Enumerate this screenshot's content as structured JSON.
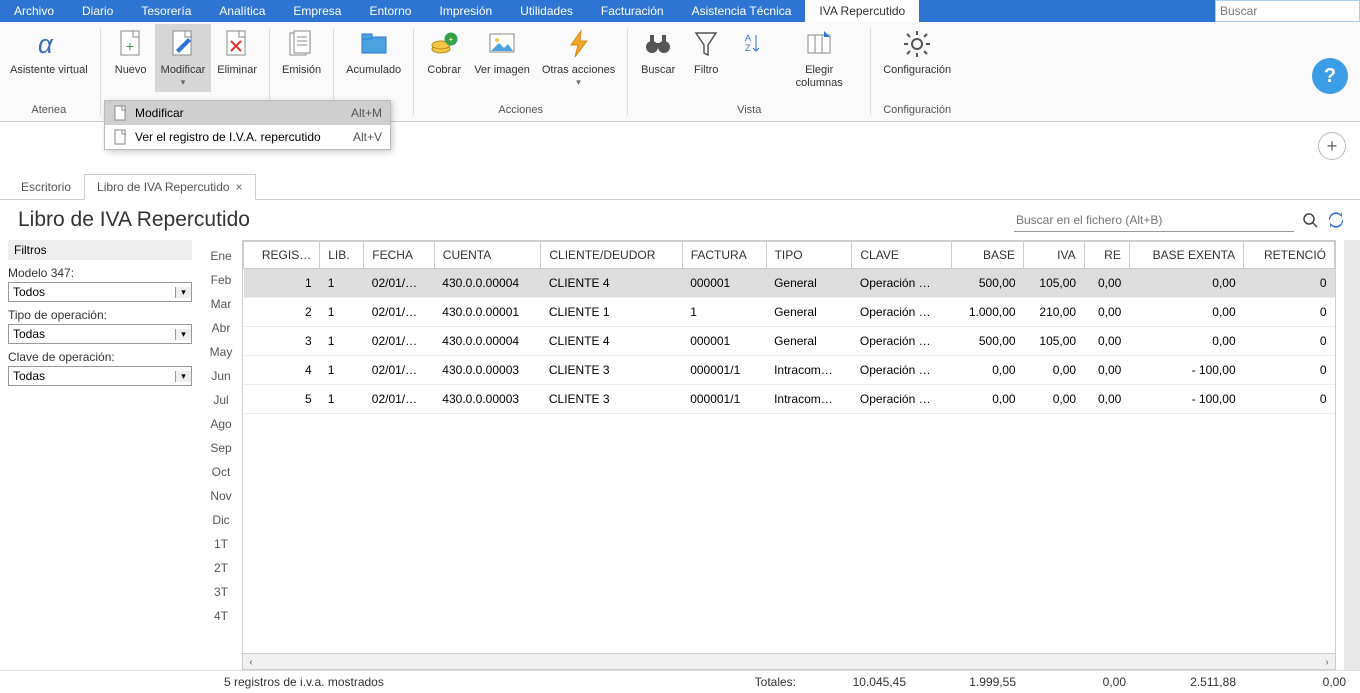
{
  "menu": {
    "items": [
      "Archivo",
      "Diario",
      "Tesorería",
      "Analítica",
      "Empresa",
      "Entorno",
      "Impresión",
      "Utilidades",
      "Facturación",
      "Asistencia Técnica",
      "IVA Repercutido"
    ],
    "active_index": 10,
    "search_placeholder": "Buscar"
  },
  "ribbon": {
    "groups": [
      {
        "label": "Atenea",
        "buttons": [
          {
            "key": "asistente",
            "label": "Asistente virtual",
            "icon": "alpha"
          }
        ]
      },
      {
        "label": "",
        "buttons": [
          {
            "key": "nuevo",
            "label": "Nuevo",
            "icon": "doc-plus"
          },
          {
            "key": "modificar",
            "label": "Modificar",
            "icon": "doc-edit",
            "has_dropdown": true,
            "active": true
          },
          {
            "key": "eliminar",
            "label": "Eliminar",
            "icon": "doc-delete"
          }
        ]
      },
      {
        "label": "",
        "buttons": [
          {
            "key": "emision",
            "label": "Emisión",
            "icon": "doc-lines"
          }
        ]
      },
      {
        "label": "",
        "buttons": [
          {
            "key": "acumulado",
            "label": "Acumulado",
            "icon": "folder"
          }
        ]
      },
      {
        "label": "Acciones",
        "buttons": [
          {
            "key": "cobrar",
            "label": "Cobrar",
            "icon": "coins"
          },
          {
            "key": "verimg",
            "label": "Ver imagen",
            "icon": "image"
          },
          {
            "key": "otras",
            "label": "Otras acciones",
            "icon": "bolt",
            "has_dropdown": true
          }
        ]
      },
      {
        "label": "Vista",
        "buttons": [
          {
            "key": "buscar",
            "label": "Buscar",
            "icon": "binoc"
          },
          {
            "key": "filtro",
            "label": "Filtro",
            "icon": "funnel"
          },
          {
            "key": "orden",
            "label": "",
            "icon": "sort",
            "narrow": true
          },
          {
            "key": "columnas",
            "label": "Elegir columnas",
            "icon": "columns"
          }
        ]
      },
      {
        "label": "Configuración",
        "buttons": [
          {
            "key": "config",
            "label": "Configuración",
            "icon": "gear"
          }
        ]
      }
    ],
    "dropdown": {
      "items": [
        {
          "label": "Modificar",
          "shortcut": "Alt+M",
          "highlight": true
        },
        {
          "label": "Ver el registro de I.V.A. repercutido",
          "shortcut": "Alt+V",
          "highlight": false
        }
      ]
    }
  },
  "doc_tabs": {
    "items": [
      {
        "label": "Escritorio",
        "closable": false,
        "active": false
      },
      {
        "label": "Libro de IVA Repercutido",
        "closable": true,
        "active": true
      }
    ]
  },
  "page": {
    "title": "Libro de IVA Repercutido",
    "file_search_placeholder": "Buscar en el fichero (Alt+B)"
  },
  "filters": {
    "panel_title": "Filtros",
    "fields": [
      {
        "label": "Modelo 347:",
        "value": "Todos"
      },
      {
        "label": "Tipo de operación:",
        "value": "Todas"
      },
      {
        "label": "Clave de operación:",
        "value": "Todas"
      }
    ]
  },
  "months": [
    "Ene",
    "Feb",
    "Mar",
    "Abr",
    "May",
    "Jun",
    "Jul",
    "Ago",
    "Sep",
    "Oct",
    "Nov",
    "Dic",
    "1T",
    "2T",
    "3T",
    "4T"
  ],
  "table": {
    "columns": [
      "REGIS…",
      "LIB.",
      "FECHA",
      "CUENTA",
      "CLIENTE/DEUDOR",
      "FACTURA",
      "TIPO",
      "CLAVE",
      "BASE",
      "IVA",
      "RE",
      "BASE EXENTA",
      "RETENCIÓ"
    ],
    "numeric_cols": [
      0,
      8,
      9,
      10,
      11,
      12
    ],
    "rows": [
      {
        "cells": [
          "1",
          "1",
          "02/01/…",
          "430.0.0.00004",
          "CLIENTE 4",
          "000001",
          "General",
          "Operación …",
          "500,00",
          "105,00",
          "0,00",
          "0,00",
          "0"
        ],
        "selected": true
      },
      {
        "cells": [
          "2",
          "1",
          "02/01/…",
          "430.0.0.00001",
          "CLIENTE 1",
          "1",
          "General",
          "Operación …",
          "1.000,00",
          "210,00",
          "0,00",
          "0,00",
          "0"
        ],
        "selected": false
      },
      {
        "cells": [
          "3",
          "1",
          "02/01/…",
          "430.0.0.00004",
          "CLIENTE 4",
          "000001",
          "General",
          "Operación …",
          "500,00",
          "105,00",
          "0,00",
          "0,00",
          "0"
        ],
        "selected": false
      },
      {
        "cells": [
          "4",
          "1",
          "02/01/…",
          "430.0.0.00003",
          "CLIENTE 3",
          "000001/1",
          "Intracom…",
          "Operación …",
          "0,00",
          "0,00",
          "0,00",
          "- 100,00",
          "0"
        ],
        "selected": false
      },
      {
        "cells": [
          "5",
          "1",
          "02/01/…",
          "430.0.0.00003",
          "CLIENTE 3",
          "000001/1",
          "Intracom…",
          "Operación …",
          "0,00",
          "0,00",
          "0,00",
          "- 100,00",
          "0"
        ],
        "selected": false
      }
    ]
  },
  "footer": {
    "count_text": "5 registros de i.v.a. mostrados",
    "totals_label": "Totales:",
    "totals": [
      "10.045,45",
      "1.999,55",
      "0,00",
      "2.511,88",
      "0,00"
    ]
  }
}
